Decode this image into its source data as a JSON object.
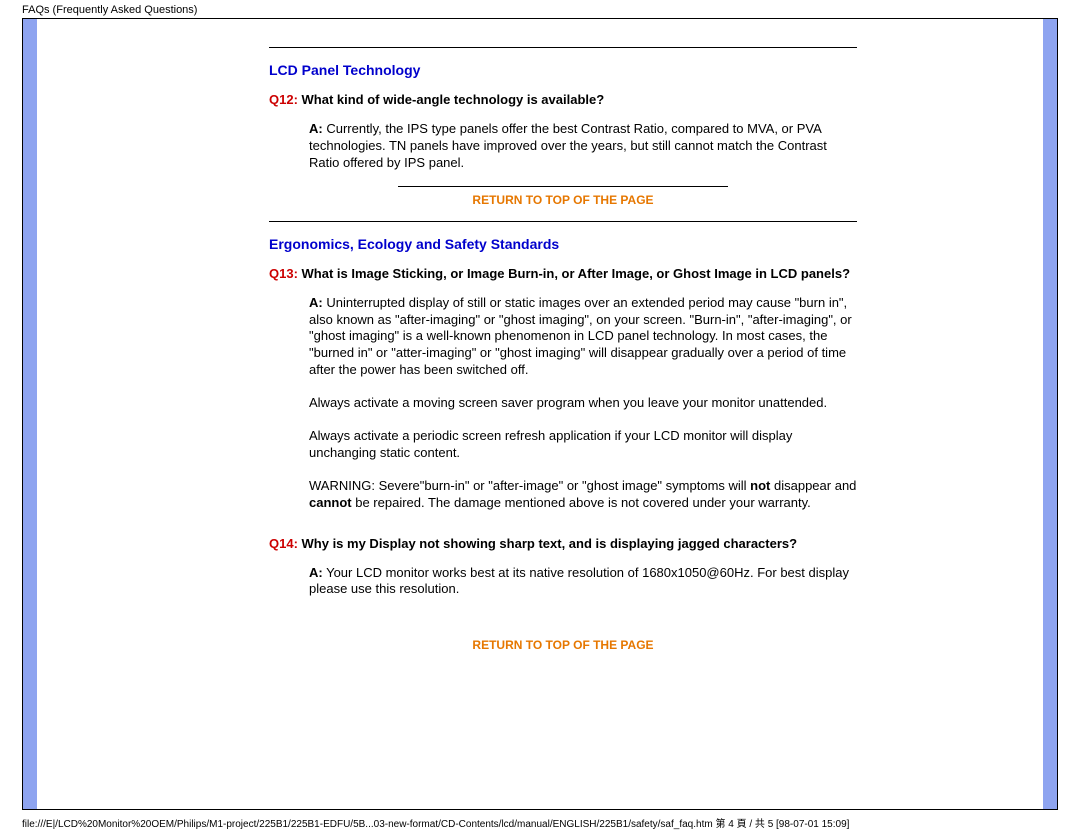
{
  "header": "FAQs (Frequently Asked Questions)",
  "section1": {
    "heading": "LCD Panel Technology",
    "q12_prefix": "Q12:",
    "q12_text": " What kind of wide-angle technology is available?",
    "a_prefix": "A:",
    "a12_text": " Currently, the IPS type panels offer the best Contrast Ratio, compared to MVA, or PVA technologies.  TN panels have improved over the years, but still cannot match the Contrast Ratio offered by IPS panel."
  },
  "return_label": "RETURN TO TOP OF THE PAGE",
  "section2": {
    "heading": "Ergonomics, Ecology and Safety Standards",
    "q13_prefix": "Q13:",
    "q13_text": " What is Image Sticking, or Image Burn-in, or After Image, or Ghost Image in LCD panels?",
    "a13_text": " Uninterrupted display of still or static images over an extended period may cause \"burn in\", also known as \"after-imaging\" or \"ghost imaging\", on your screen. \"Burn-in\", \"after-imaging\", or \"ghost imaging\" is a well-known phenomenon in LCD panel technology. In most cases, the \"burned in\" or \"atter-imaging\" or \"ghost imaging\" will disappear gradually over a period of time after the power has been switched off.",
    "a13_p2": "Always activate a moving screen saver program when you leave your monitor unattended.",
    "a13_p3": "Always activate a periodic screen refresh application if your LCD monitor will display unchanging static content.",
    "a13_warn_pre": "WARNING: Severe\"burn-in\" or \"after-image\" or \"ghost image\" symptoms will ",
    "a13_warn_not": "not",
    "a13_warn_mid": " disappear and ",
    "a13_warn_cannot": "cannot",
    "a13_warn_post": " be repaired. The damage mentioned above is not covered under your warranty.",
    "q14_prefix": "Q14:",
    "q14_text": " Why is my Display not showing sharp text, and is displaying jagged characters?",
    "a14_text": " Your LCD monitor works best at its native resolution of 1680x1050@60Hz. For best display please use this resolution."
  },
  "footer": "file:///E|/LCD%20Monitor%20OEM/Philips/M1-project/225B1/225B1-EDFU/5B...03-new-format/CD-Contents/lcd/manual/ENGLISH/225B1/safety/saf_faq.htm 第 4 頁 / 共 5  [98-07-01 15:09]"
}
